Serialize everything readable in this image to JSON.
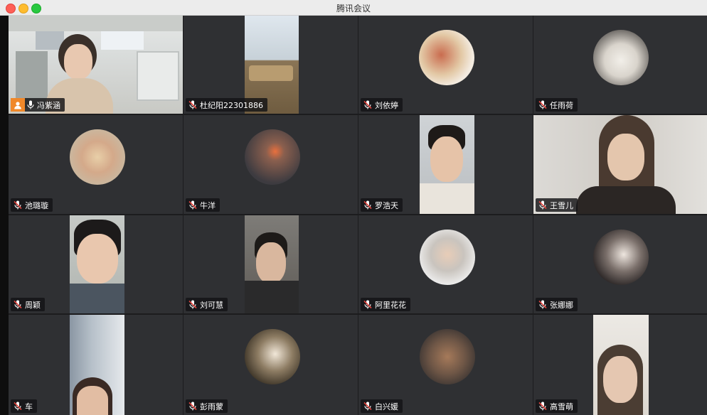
{
  "window": {
    "title": "腾讯会议"
  },
  "participants": [
    {
      "name": "冯紫涵",
      "media": "video",
      "mic": "on",
      "host": true
    },
    {
      "name": "杜纪阳22301886",
      "media": "video",
      "mic": "muted"
    },
    {
      "name": "刘依婷",
      "media": "avatar",
      "mic": "muted"
    },
    {
      "name": "任雨荷",
      "media": "avatar",
      "mic": "muted"
    },
    {
      "name": "池璐璇",
      "media": "avatar",
      "mic": "muted"
    },
    {
      "name": "牛洋",
      "media": "avatar",
      "mic": "muted"
    },
    {
      "name": "罗浩天",
      "media": "video",
      "mic": "muted"
    },
    {
      "name": "王雪儿",
      "media": "video",
      "mic": "muted"
    },
    {
      "name": "周颖",
      "media": "video",
      "mic": "muted"
    },
    {
      "name": "刘可慧",
      "media": "video",
      "mic": "muted"
    },
    {
      "name": "阿里花花",
      "media": "avatar",
      "mic": "muted"
    },
    {
      "name": "张娜娜",
      "media": "avatar",
      "mic": "muted"
    },
    {
      "name": "车",
      "media": "video",
      "mic": "muted"
    },
    {
      "name": "彭雨蒙",
      "media": "avatar",
      "mic": "muted"
    },
    {
      "name": "白兴媛",
      "media": "avatar",
      "mic": "muted"
    },
    {
      "name": "高雪萌",
      "media": "video",
      "mic": "muted"
    }
  ],
  "colors": {
    "tile_bg": "#2f3033",
    "host_badge": "#f0882a",
    "muted_slash": "#e0443e"
  }
}
